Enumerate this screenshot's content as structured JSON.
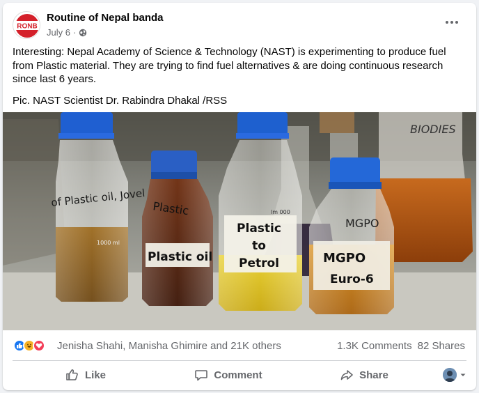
{
  "post": {
    "page_name": "Routine of Nepal banda",
    "avatar_text": "RONB",
    "date": "July 6",
    "privacy_icon": "globe-icon",
    "text_paragraph_1": "Interesting: Nepal Academy of Science & Technology (NAST) is experimenting to produce fuel from Plastic material. They are trying to find fuel alternatives & are doing continuous research since last 6 years.",
    "text_paragraph_2": "Pic. NAST Scientist Dr. Rabindra Dhakal /RSS"
  },
  "photo": {
    "labels": {
      "bottle1": "of Plastic oil, Jovel",
      "bottle2a": "Plastic",
      "bottle2b": "Plastic oil",
      "bottle3a": "Plastic",
      "bottle3b": "to",
      "bottle3c": "Petrol",
      "bottle4a": "MGPO",
      "bottle4b": "MGPO",
      "bottle4c": "Euro-6",
      "flask": "BIODIES",
      "vol1": "1000 ml",
      "vol2": "lm 000"
    }
  },
  "engagement": {
    "reaction_icons": [
      "like-icon",
      "haha-icon",
      "love-icon"
    ],
    "reactors": "Jenisha Shahi, Manisha Ghimire and 21K others",
    "comments": "1.3K Comments",
    "shares": "82 Shares"
  },
  "actions": {
    "like": "Like",
    "comment": "Comment",
    "share": "Share"
  },
  "colors": {
    "brand_red": "#d4202a",
    "like_blue": "#1877f2",
    "love_red": "#f33e58",
    "haha_yellow": "#f7b125",
    "text_secondary": "#65676b"
  }
}
